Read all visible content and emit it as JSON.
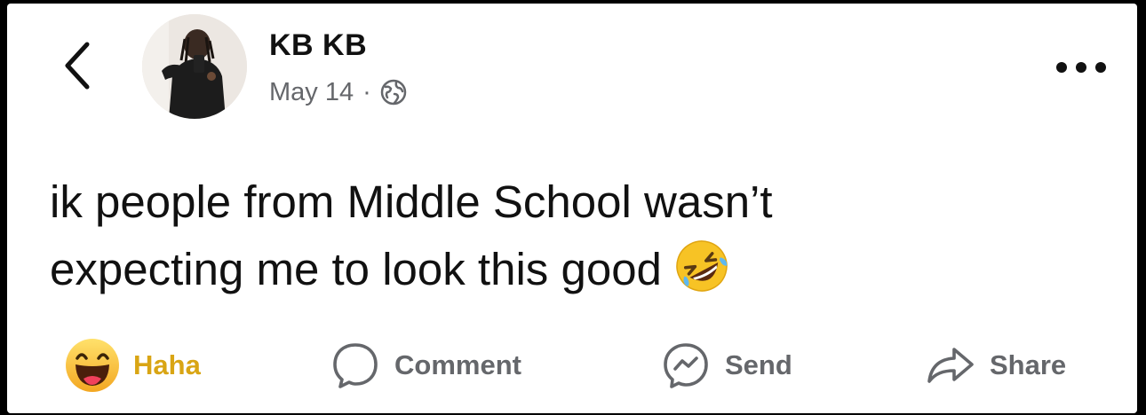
{
  "post": {
    "author": "KB KB",
    "date": "May 14",
    "separator": "·",
    "privacy_icon": "globe-icon",
    "text_line1": "ik people from Middle School wasn’t",
    "text_line2": "expecting me to look this good",
    "emoji": "rolling-on-floor-laughing-emoji"
  },
  "header": {
    "back_icon": "chevron-left-icon",
    "more_icon": "more-horizontal-icon"
  },
  "actions": {
    "haha_label": "Haha",
    "comment_label": "Comment",
    "send_label": "Send",
    "share_label": "Share"
  },
  "colors": {
    "text": "#111111",
    "muted": "#65676b",
    "haha": "#d9a514",
    "emoji_yellow": "#f7c325"
  }
}
